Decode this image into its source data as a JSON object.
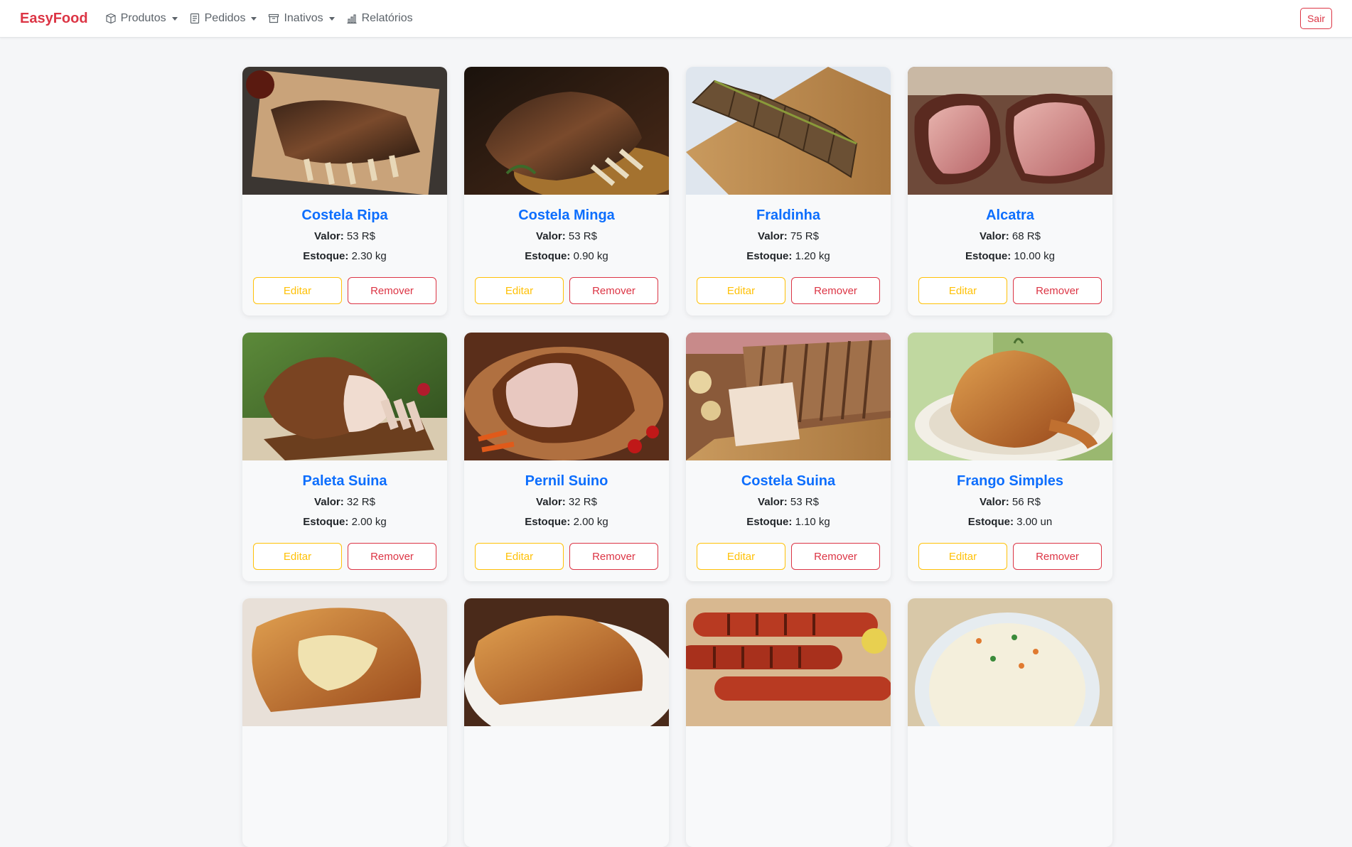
{
  "brand": "EasyFood",
  "nav": [
    {
      "label": "Produtos",
      "icon": "box-icon",
      "dropdown": true
    },
    {
      "label": "Pedidos",
      "icon": "receipt-icon",
      "dropdown": true
    },
    {
      "label": "Inativos",
      "icon": "archive-icon",
      "dropdown": true
    },
    {
      "label": "Relatórios",
      "icon": "bar-chart-icon",
      "dropdown": false
    }
  ],
  "logout_label": "Sair",
  "labels": {
    "value": "Valor:",
    "stock": "Estoque:",
    "edit": "Editar",
    "remove": "Remover"
  },
  "products": [
    {
      "name": "Costela Ripa",
      "value": "53 R$",
      "stock": "2.30 kg",
      "image": "beef-ribs"
    },
    {
      "name": "Costela Minga",
      "value": "53 R$",
      "stock": "0.90 kg",
      "image": "rib-roast"
    },
    {
      "name": "Fraldinha",
      "value": "75 R$",
      "stock": "1.20 kg",
      "image": "sliced-flank-steak"
    },
    {
      "name": "Alcatra",
      "value": "68 R$",
      "stock": "10.00 kg",
      "image": "top-sirloin"
    },
    {
      "name": "Paleta Suina",
      "value": "32 R$",
      "stock": "2.00 kg",
      "image": "pork-shoulder"
    },
    {
      "name": "Pernil Suino",
      "value": "32 R$",
      "stock": "2.00 kg",
      "image": "pork-leg"
    },
    {
      "name": "Costela Suina",
      "value": "53 R$",
      "stock": "1.10 kg",
      "image": "pork-ribs"
    },
    {
      "name": "Frango Simples",
      "value": "56 R$",
      "stock": "3.00 un",
      "image": "roast-chicken"
    },
    {
      "name": "",
      "value": "",
      "stock": "",
      "image": "stuffed-chicken"
    },
    {
      "name": "",
      "value": "",
      "stock": "",
      "image": "roasted-chicken-pieces"
    },
    {
      "name": "",
      "value": "",
      "stock": "",
      "image": "sausages"
    },
    {
      "name": "",
      "value": "",
      "stock": "",
      "image": "potato-salad"
    }
  ],
  "colors": {
    "brand": "#dc3545",
    "title": "#0d6efd",
    "edit": "#ffc107",
    "remove": "#dc3545",
    "background": "#f5f6f8"
  }
}
